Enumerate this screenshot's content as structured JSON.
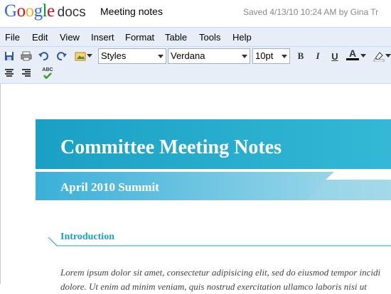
{
  "app": {
    "logo_google": "Google",
    "logo_docs": "docs",
    "doc_title": "Meeting notes",
    "saved_status": "Saved 4/13/10 10:24 AM by Gina Tr"
  },
  "menu": [
    "File",
    "Edit",
    "View",
    "Insert",
    "Format",
    "Table",
    "Tools",
    "Help"
  ],
  "toolbar": {
    "style_value": "Styles",
    "font_value": "Verdana",
    "size_value": "10pt",
    "bold": "B",
    "italic": "I",
    "underline": "U",
    "textcolor": "A",
    "spell": "ABC"
  },
  "document": {
    "title": "Committee Meeting Notes",
    "subtitle": "April 2010 Summit",
    "section_heading": "Introduction",
    "body_line1": "Lorem ipsum dolor sit amet, consectetur adipisicing elit, sed do eiusmod tempor incidi",
    "body_line2": "dolore. Ut enim ad minim veniam, quis nostrud exercitation ullamco laboris nisi ut"
  },
  "colors": {
    "accent": "#1aa0c4",
    "toolbar_bg": "#e8eef7"
  }
}
